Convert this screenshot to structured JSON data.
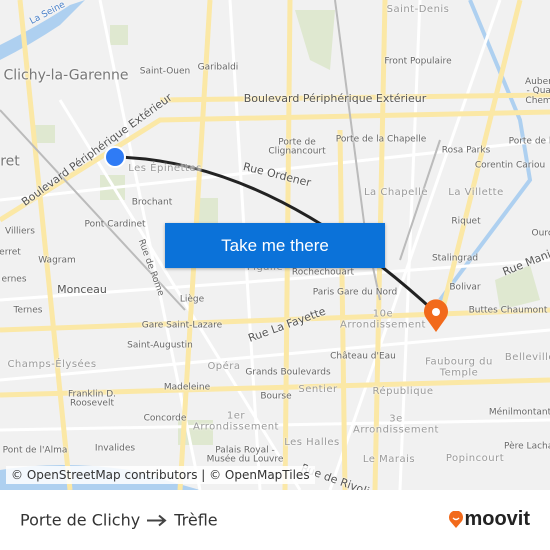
{
  "map": {
    "labels": [
      "La Seine",
      "Saint-Denis",
      "Clichy-la-Garenne",
      "Saint-Ouen",
      "Garibaldi",
      "Front Populaire",
      "Boulevard Périphérique Extérieur",
      "Boulevard Périphérique Extérieur",
      "Porte de Clignancourt",
      "Porte de la Chapelle",
      "Rosa Parks",
      "Porte de la Villette",
      "Corentin Cariou",
      "ret",
      "Les Épinettes",
      "Rue Ordener",
      "La Chapelle",
      "La Villette",
      "Brochant",
      "Pont Cardinet",
      "Riquet",
      "Ourcq",
      "Rue de Rome",
      "Wagram",
      "erret",
      "ernes",
      "Monceau",
      "Liège",
      "Pigalle",
      "Rochechouart",
      "Stalingrad",
      "Rue Manin",
      "Paris Gare du Nord",
      "Bolivar",
      "Rue La Fayette",
      "10e Arrondissement",
      "Buttes Chaumont",
      "Ternes",
      "Gare Saint-Lazare",
      "Saint-Augustin",
      "Château d'Eau",
      "Faubourg du Temple",
      "Belleville",
      "Champs-Élysées",
      "Opéra",
      "Grands Boulevards",
      "Sentier",
      "République",
      "Ménilmontant",
      "Madeleine",
      "Franklin D. Roosevelt",
      "Bourse",
      "Concorde",
      "1er Arrondissement",
      "3e Arrondissement",
      "Les Halles",
      "Popincourt",
      "Invalides",
      "Palais Royal - Musée du Louvre",
      "Le Marais",
      "Pont de l'Alma",
      "Père Lachaise",
      "Rue de Rivoli",
      "Aubervilliers - Quatre Chemins",
      "Villiers"
    ],
    "attribution": "© OpenStreetMap contributors | © OpenMapTiles",
    "origin_marker_color": "#2f7bf5",
    "destination_marker_color": "#f26a1b",
    "route_color": "#222222",
    "cta_label": "Take me there",
    "cta_color": "#0b72d9"
  },
  "footer": {
    "origin": "Porte de Clichy",
    "arrow_icon": "arrow-right-icon",
    "destination": "Trèfle",
    "brand": "moovit",
    "brand_color": "#f26a1b"
  }
}
